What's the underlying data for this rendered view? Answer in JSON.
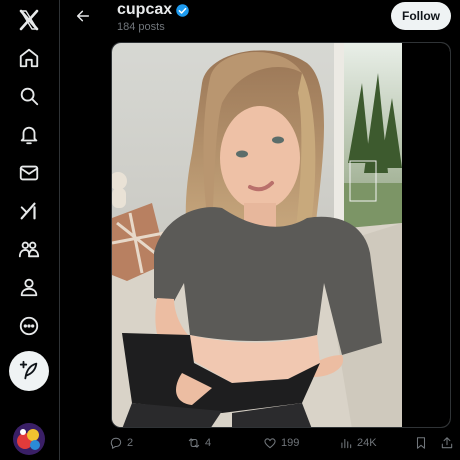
{
  "header": {
    "profile_name": "cupcax",
    "post_count": "184 posts",
    "follow_label": "Follow"
  },
  "nav": [
    {
      "name": "x-logo-icon"
    },
    {
      "name": "home-icon"
    },
    {
      "name": "search-icon"
    },
    {
      "name": "notifications-icon"
    },
    {
      "name": "messages-icon"
    },
    {
      "name": "grok-icon"
    },
    {
      "name": "communities-icon"
    },
    {
      "name": "profile-icon"
    },
    {
      "name": "more-icon"
    }
  ],
  "actions": {
    "replies": "2",
    "reposts": "4",
    "likes": "199",
    "views": "24K"
  },
  "colors": {
    "background": "#000000",
    "text": "#e7e9ea",
    "muted": "#71767b",
    "verified": "#1d9bf0",
    "follow_bg": "#eff3f4"
  }
}
